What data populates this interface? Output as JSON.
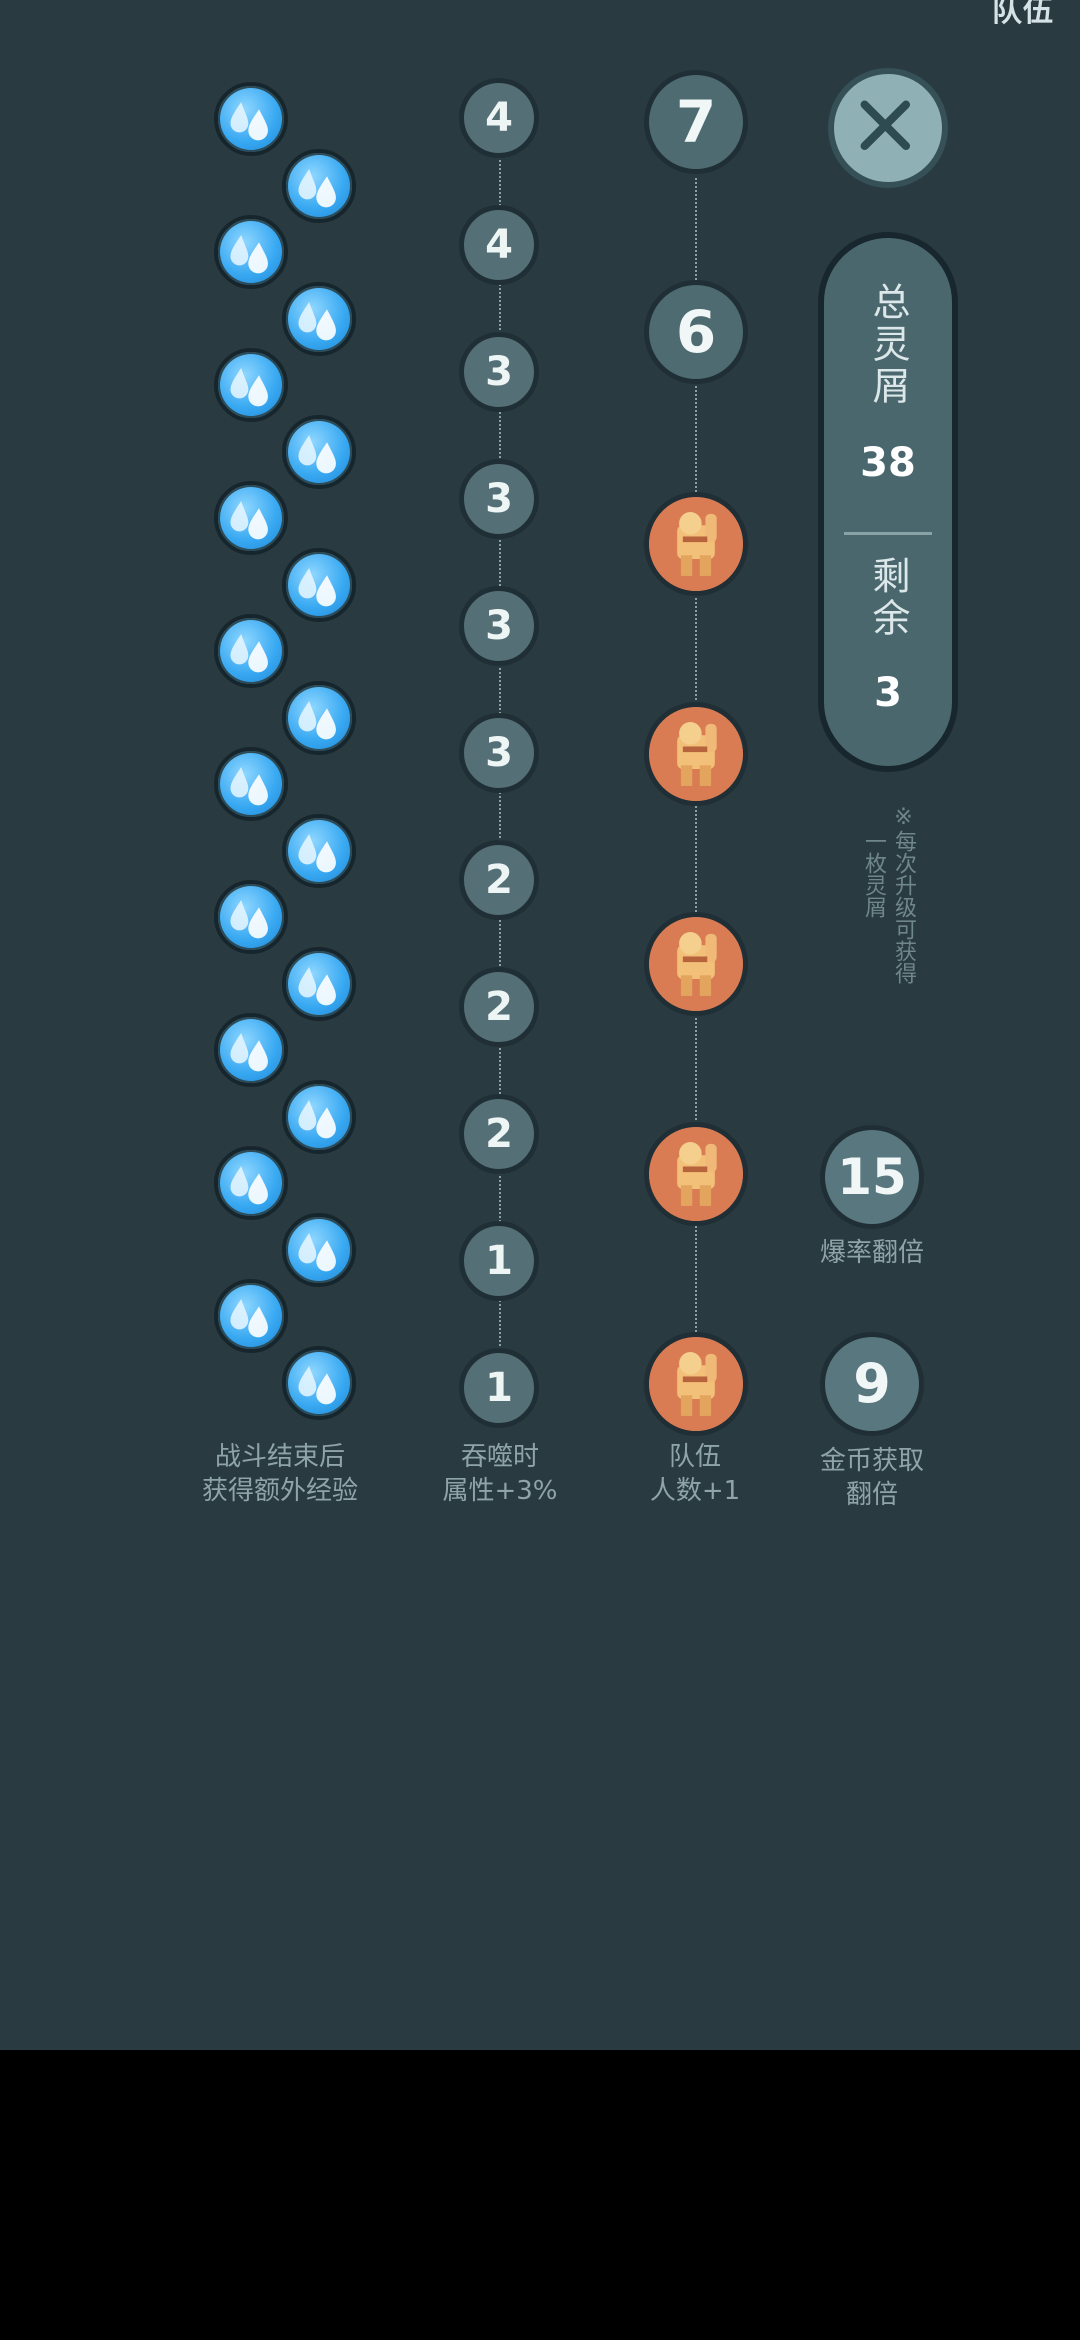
{
  "header": {
    "corner_label": "队伍"
  },
  "experience_column": {
    "caption": "战斗结束后\n获得额外经验",
    "drop_count": 20,
    "icon": "water-drop-icon"
  },
  "devour_column": {
    "values": [
      "4",
      "4",
      "3",
      "3",
      "3",
      "3",
      "2",
      "2",
      "2",
      "1",
      "1"
    ],
    "caption": "吞噬时\n属性+3%"
  },
  "team_column": {
    "top_values": [
      "7",
      "6"
    ],
    "unlocked_icons": 5,
    "icon": "warrior-portrait-icon",
    "caption": "队伍\n人数+1"
  },
  "summary": {
    "total_label": "总灵屑",
    "total_value": "38",
    "remaining_label": "剩余",
    "remaining_value": "3",
    "note_line1": "※每次升级可获得",
    "note_line2": "一枚灵屑"
  },
  "bonuses": [
    {
      "value": "15",
      "caption": "爆率翻倍"
    },
    {
      "value": "9",
      "caption": "金币获取\n翻倍"
    }
  ],
  "colors": {
    "background": "#293a41",
    "drop": "#39a9f2",
    "accent_orange": "#d97c54"
  }
}
